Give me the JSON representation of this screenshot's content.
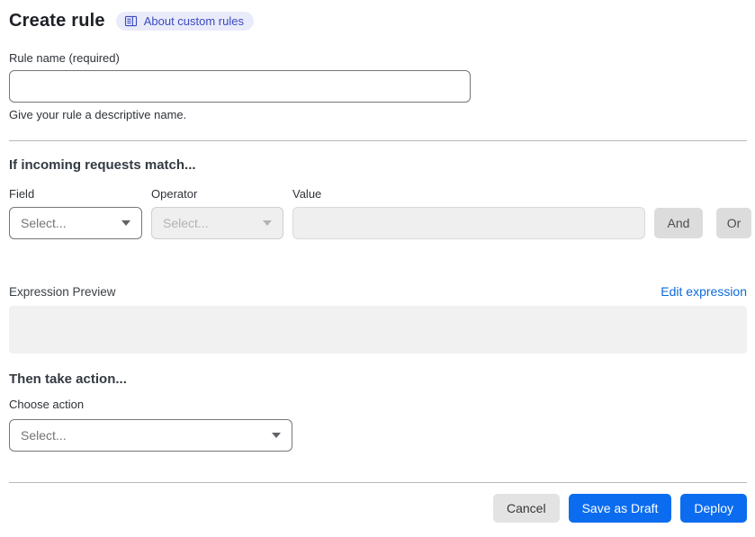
{
  "header": {
    "title": "Create rule",
    "about_badge": "About custom rules"
  },
  "rule_name": {
    "label": "Rule name (required)",
    "value": "",
    "helper": "Give your rule a descriptive name."
  },
  "match_section": {
    "heading": "If incoming requests match...",
    "field": {
      "label": "Field",
      "selected": "Select..."
    },
    "operator": {
      "label": "Operator",
      "selected": "Select..."
    },
    "value": {
      "label": "Value",
      "value": ""
    },
    "and_button": "And",
    "or_button": "Or"
  },
  "expression": {
    "label": "Expression Preview",
    "edit_link": "Edit expression",
    "preview": ""
  },
  "action_section": {
    "heading": "Then take action...",
    "choose_label": "Choose action",
    "selected": "Select..."
  },
  "footer": {
    "cancel": "Cancel",
    "save_draft": "Save as Draft",
    "deploy": "Deploy"
  },
  "colors": {
    "primary_blue": "#0b6cf0",
    "link_blue": "#0d6bd8",
    "badge_background": "#e9ebfa",
    "badge_text": "#3b49c0",
    "disabled_background": "#efefef",
    "chip_background": "#dcdcdc",
    "cancel_background": "#e3e3e3",
    "preview_background": "#f1f1f1"
  }
}
